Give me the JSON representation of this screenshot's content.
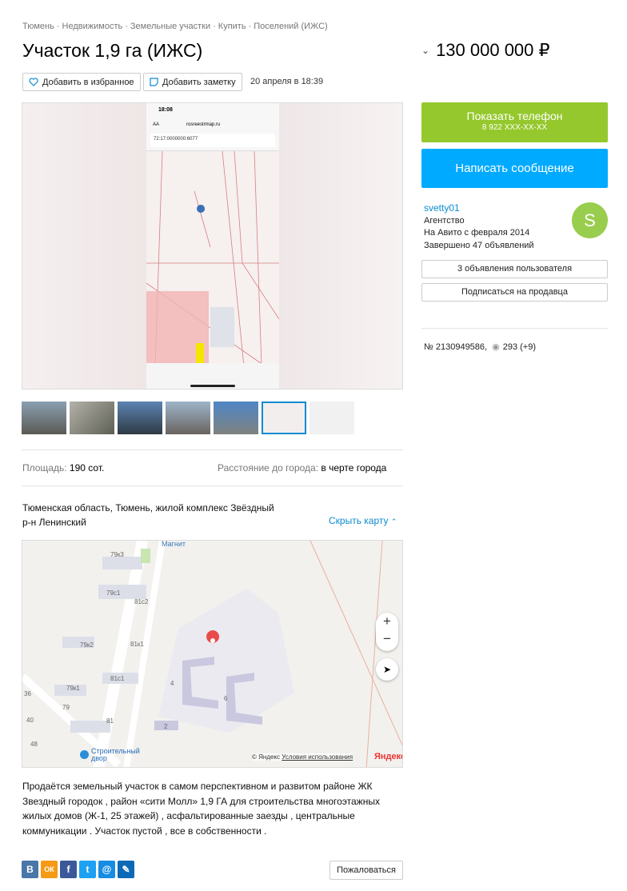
{
  "breadcrumbs": [
    "Тюмень",
    "Недвижимость",
    "Земельные участки",
    "Купить",
    "Поселений (ИЖС)"
  ],
  "breadcrumb_sep": "·",
  "title": "Участок 1,9 га (ИЖС)",
  "price": "130 000 000 ₽",
  "actions": {
    "favorite": "Добавить в избранное",
    "note": "Добавить заметку",
    "date": "20 апреля в 18:39"
  },
  "phone_screenshot": {
    "time": "18:08",
    "font_btn": "AA",
    "url": "rosreestrmap.ru",
    "search": "72:17:0000000:6077"
  },
  "params": {
    "area_label": "Площадь:",
    "area_value": "190 сот.",
    "distance_label": "Расстояние до города:",
    "distance_value": "в черте города"
  },
  "address": {
    "line1": "Тюменская область, Тюмень, жилой комплекс Звёздный",
    "line2": "р-н Ленинский",
    "hide_map": "Скрыть карту"
  },
  "map": {
    "labels": [
      "Магнит",
      "79к3",
      "79с1",
      "81с2",
      "79к2",
      "81к1",
      "81с1",
      "79к1",
      "79",
      "81",
      "4",
      "6",
      "2",
      "36",
      "40",
      "48"
    ],
    "poi": "Строительный двор",
    "copyright": "© Яндекс",
    "terms": "Условия использования",
    "brand": "Яндекс",
    "zoom_in": "+",
    "zoom_out": "−"
  },
  "description": "Продаётся земельный участок в самом перспективном и развитом районе ЖК Звездный городок , район «сити Молл» 1,9 ГА для строительства многоэтажных жилых домов (Ж-1, 25 этажей) , асфальтированные заезды , центральные коммуникации . Участок пустой , все в собственности .",
  "contact": {
    "show_phone": "Показать телефон",
    "phone_masked": "8 922 XXX-XX-XX",
    "write": "Написать сообщение"
  },
  "seller": {
    "name": "svetty01",
    "type": "Агентство",
    "since": "На Авито с февраля 2014",
    "completed": "Завершено 47 объявлений",
    "avatar_letter": "S",
    "listings_btn": "3 объявления пользователя",
    "subscribe_btn": "Подписаться на продавца"
  },
  "meta": {
    "number": "№ 2130949586,",
    "views": "293 (+9)"
  },
  "social": [
    "В",
    "ОК",
    "f",
    "t",
    "@",
    "✎"
  ],
  "social_colors": [
    "#4a76a8",
    "#f59a15",
    "#3b5998",
    "#1da1f2",
    "#168de2",
    "#0b69b6"
  ],
  "report": "Пожаловаться",
  "colors": {
    "green": "#94c82c",
    "blue": "#00aaff",
    "link": "#0a8bd0",
    "avatar": "#99cd4e",
    "pin": "#e94a4a"
  }
}
